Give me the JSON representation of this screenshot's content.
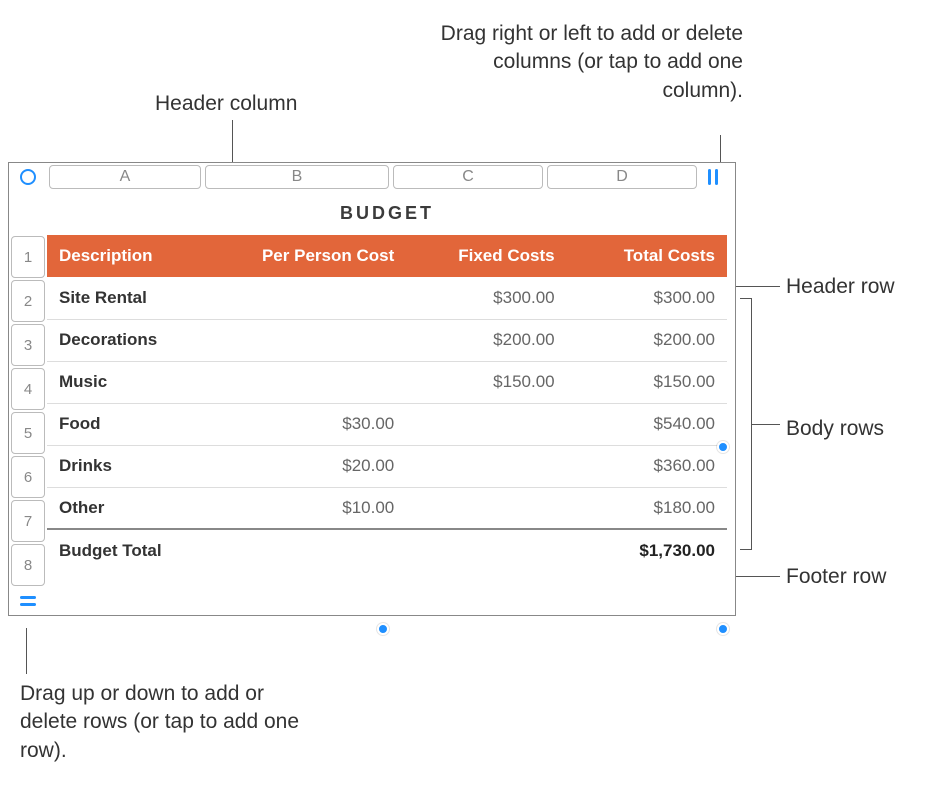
{
  "callouts": {
    "header_column": "Header column",
    "add_columns": "Drag right or left to add or delete columns (or tap to add one column).",
    "header_row": "Header row",
    "body_rows": "Body rows",
    "footer_row": "Footer row",
    "add_rows": "Drag up or down to add or delete rows (or tap to add one row)."
  },
  "table": {
    "title": "BUDGET",
    "columns": {
      "letters": [
        "A",
        "B",
        "C",
        "D"
      ],
      "headers": [
        "Description",
        "Per Person Cost",
        "Fixed Costs",
        "Total Costs"
      ]
    },
    "row_numbers": [
      "1",
      "2",
      "3",
      "4",
      "5",
      "6",
      "7",
      "8"
    ],
    "rows": [
      {
        "desc": "Site Rental",
        "per_person": "",
        "fixed": "$300.00",
        "total": "$300.00"
      },
      {
        "desc": "Decorations",
        "per_person": "",
        "fixed": "$200.00",
        "total": "$200.00"
      },
      {
        "desc": "Music",
        "per_person": "",
        "fixed": "$150.00",
        "total": "$150.00"
      },
      {
        "desc": "Food",
        "per_person": "$30.00",
        "fixed": "",
        "total": "$540.00"
      },
      {
        "desc": "Drinks",
        "per_person": "$20.00",
        "fixed": "",
        "total": "$360.00"
      },
      {
        "desc": "Other",
        "per_person": "$10.00",
        "fixed": "",
        "total": "$180.00"
      }
    ],
    "footer": {
      "desc": "Budget Total",
      "per_person": "",
      "fixed": "",
      "total": "$1,730.00"
    }
  },
  "colors": {
    "accent": "#1f8fff",
    "header_bg": "#e2663a"
  }
}
